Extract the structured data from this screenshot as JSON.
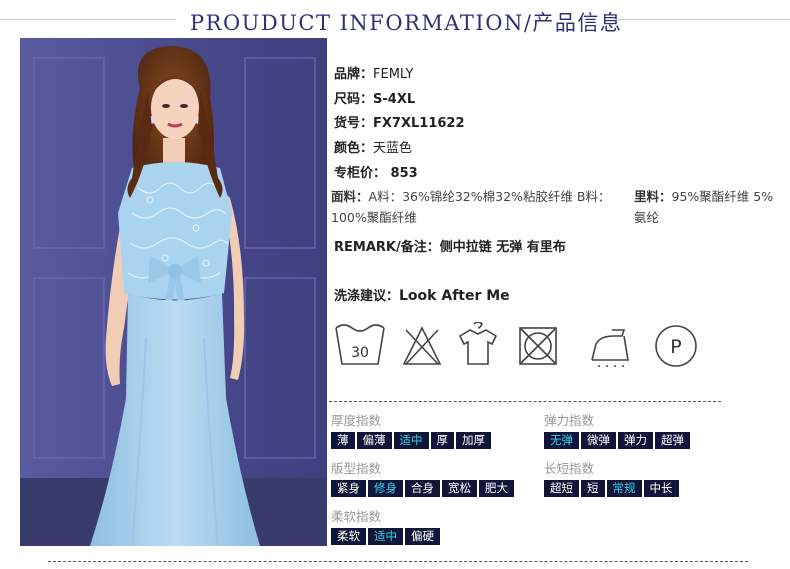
{
  "header": {
    "title": "PROUDUCT INFORMATION/产品信息"
  },
  "product_photo": {
    "alt": "Model wearing a sky blue lace short-sleeve top with bow and fishtail midi skirt"
  },
  "specs": {
    "brand": {
      "label": "品牌：",
      "value": "FEMLY"
    },
    "size": {
      "label": "尺码：",
      "value": "S-4XL"
    },
    "item_no": {
      "label": "货号：",
      "value": "FX7XL11622"
    },
    "color": {
      "label": "颜色：",
      "value": "天蓝色"
    },
    "price": {
      "label": "专柜价：",
      "value": "853"
    }
  },
  "fabric": {
    "label": "面料：",
    "text": "A料：36%锦纶32%棉32%粘胶纤维 B料：100%聚酯纤维"
  },
  "lining": {
    "label": "里料：",
    "text": "95%聚酯纤维 5%氨纶"
  },
  "remark": {
    "label": "REMARK/备注：",
    "value": "侧中拉链 无弹 有里布"
  },
  "washing": {
    "label": "洗涤建议：",
    "value": "Look After Me"
  },
  "care_icons": [
    {
      "name": "wash-30-icon",
      "text": "30"
    },
    {
      "name": "no-bleach-icon"
    },
    {
      "name": "hang-dry-icon"
    },
    {
      "name": "no-tumble-dry-icon"
    },
    {
      "name": "iron-icon"
    },
    {
      "name": "dry-clean-p-icon",
      "text": "P"
    }
  ],
  "scales": {
    "thickness": {
      "label": "厚度指数",
      "options": [
        "薄",
        "偏薄",
        "适中",
        "厚",
        "加厚"
      ],
      "selected": "适中"
    },
    "elasticity": {
      "label": "弹力指数",
      "options": [
        "无弹",
        "微弹",
        "弹力",
        "超弹"
      ],
      "selected": "无弹"
    },
    "fit": {
      "label": "版型指数",
      "options": [
        "紧身",
        "修身",
        "合身",
        "宽松",
        "肥大"
      ],
      "selected": "修身"
    },
    "length": {
      "label": "长短指数",
      "options": [
        "超短",
        "短",
        "常规",
        "中长"
      ],
      "selected": "常规"
    },
    "softness": {
      "label": "柔软指数",
      "options": [
        "柔软",
        "适中",
        "偏硬"
      ],
      "selected": "适中"
    }
  },
  "colors": {
    "title": "#2c3378",
    "chip_bg": "#101638",
    "chip_selected_text": "#35d0f0",
    "dress": "#a9d3ee",
    "wall": "#4a4a8e"
  }
}
